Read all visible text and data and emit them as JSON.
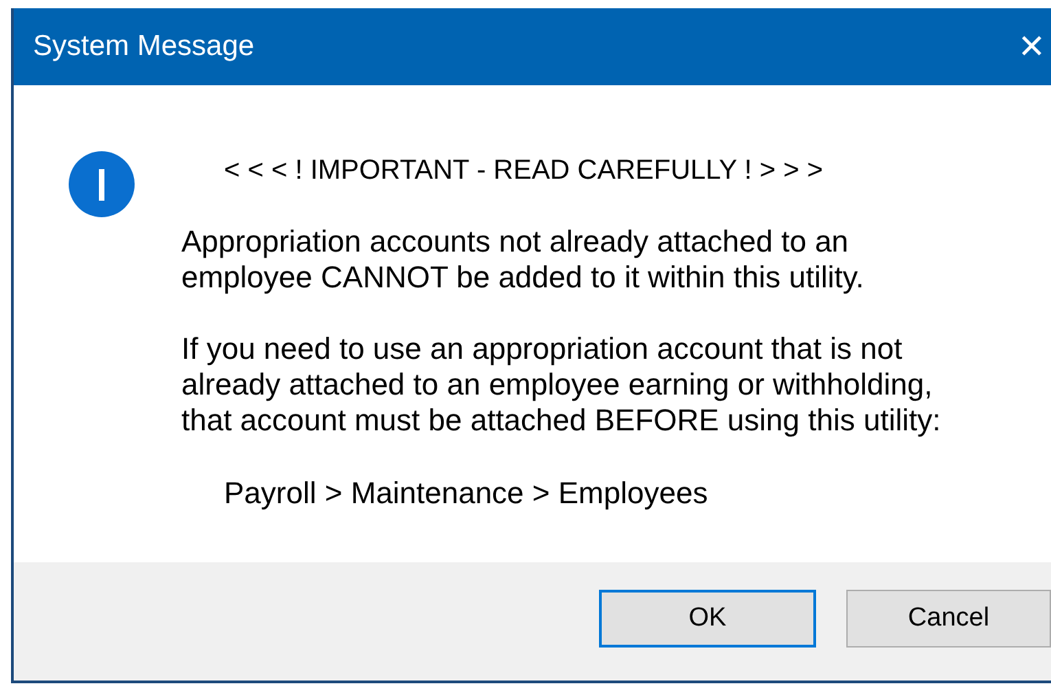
{
  "window": {
    "title": "System Message",
    "close": "✕"
  },
  "message": {
    "kind": "info",
    "heading": "< < < ! IMPORTANT - READ CAREFULLY ! > > >",
    "paragraphs": [
      {
        "lines": [
          "Appropriation accounts not already attached to an",
          "employee CANNOT be added to it within this utility."
        ]
      },
      {
        "lines": [
          "If you need to use an appropriation account that is not",
          "already attached to an employee earning or withholding,",
          "that account must be attached BEFORE using this utility:"
        ]
      }
    ],
    "path": "Payroll > Maintenance > Employees"
  },
  "buttons": [
    {
      "label": "OK",
      "focused": true
    },
    {
      "label": "Cancel",
      "focused": false
    }
  ]
}
